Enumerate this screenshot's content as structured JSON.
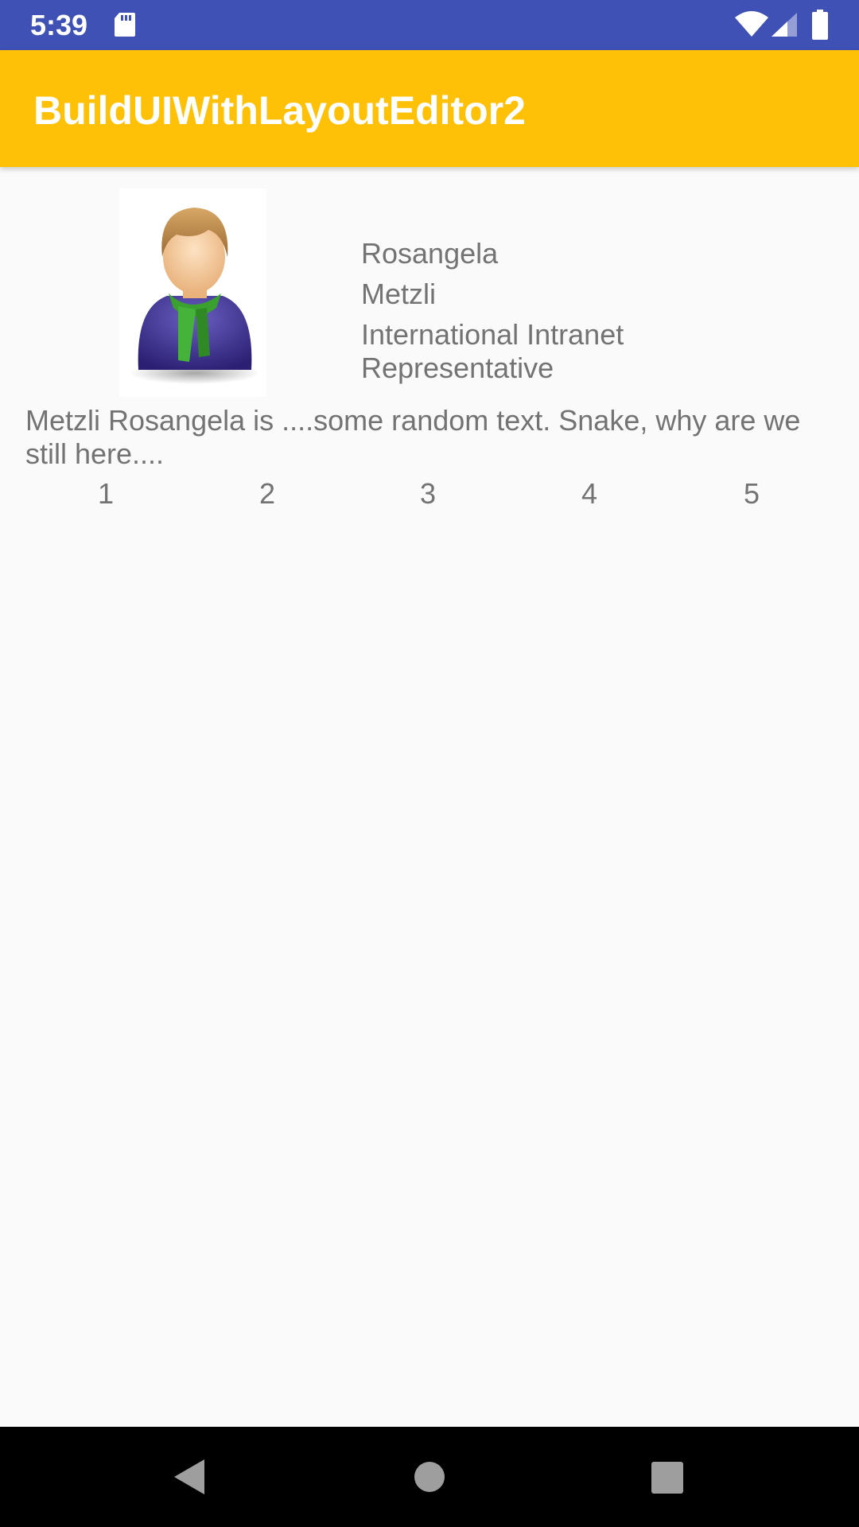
{
  "status_bar": {
    "time": "5:39",
    "icons": [
      "sd-card-icon",
      "wifi-icon",
      "cellular-signal-icon",
      "battery-icon"
    ],
    "background": "#3f51b5"
  },
  "app_bar": {
    "title": "BuildUIWithLayoutEditor2",
    "background": "#ffc107"
  },
  "profile": {
    "avatar_icon": "person-avatar-icon",
    "first_name": "Rosangela",
    "last_name": "Metzli",
    "job_title": "International Intranet Representative",
    "bio": "Metzli Rosangela is ....some random text. Snake, why are we still here...."
  },
  "numbers": [
    "1",
    "2",
    "3",
    "4",
    "5"
  ],
  "nav_bar": {
    "icons": [
      "back-icon",
      "home-icon",
      "recents-icon"
    ],
    "background": "#000000"
  }
}
